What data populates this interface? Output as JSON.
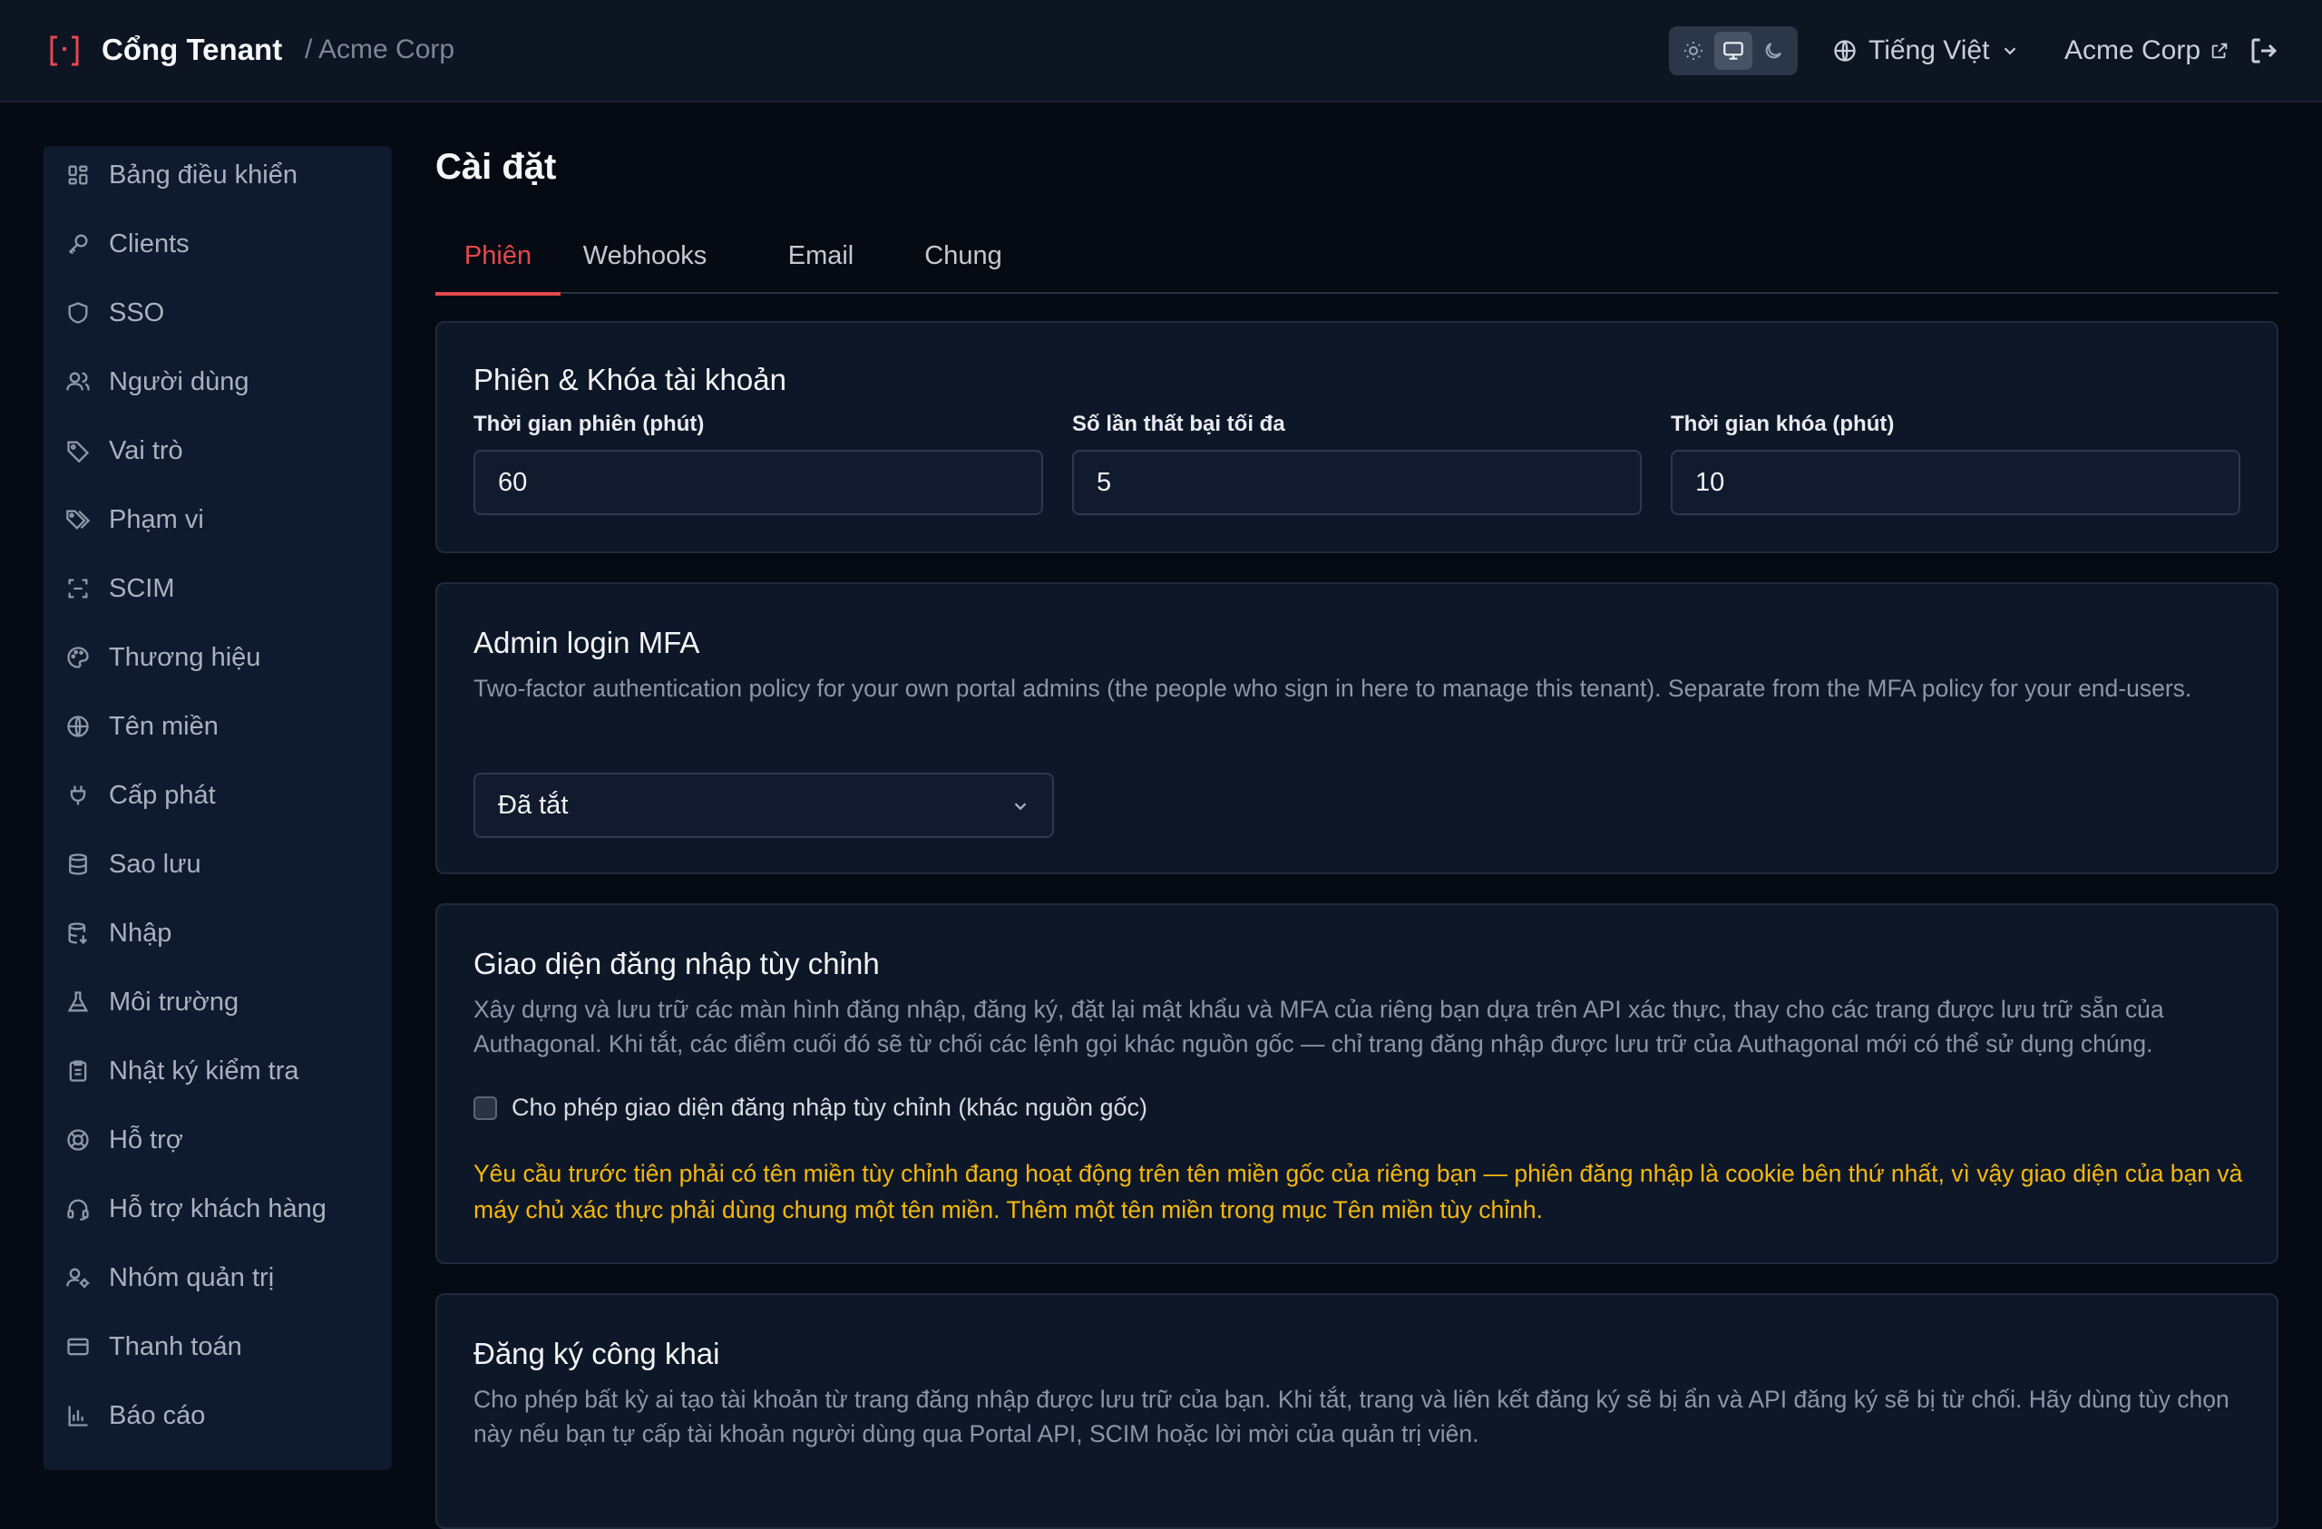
{
  "header": {
    "title": "Cổng Tenant",
    "breadcrumb": "/ Acme Corp",
    "language": "Tiếng Việt",
    "tenant_link": "Acme Corp",
    "theme_modes": [
      "light",
      "system",
      "dark"
    ],
    "theme_active": "system"
  },
  "sidebar": {
    "items": [
      {
        "label": "Bảng điều khiển",
        "icon": "dashboard-icon"
      },
      {
        "label": "Clients",
        "icon": "key-icon"
      },
      {
        "label": "SSO",
        "icon": "shield-icon"
      },
      {
        "label": "Người dùng",
        "icon": "users-icon"
      },
      {
        "label": "Vai trò",
        "icon": "tag-icon"
      },
      {
        "label": "Phạm vi",
        "icon": "tags-icon"
      },
      {
        "label": "SCIM",
        "icon": "scan-icon"
      },
      {
        "label": "Thương hiệu",
        "icon": "palette-icon"
      },
      {
        "label": "Tên miền",
        "icon": "globe-icon"
      },
      {
        "label": "Cấp phát",
        "icon": "plug-icon"
      },
      {
        "label": "Sao lưu",
        "icon": "database-icon"
      },
      {
        "label": "Nhập",
        "icon": "database-import-icon"
      },
      {
        "label": "Môi trường",
        "icon": "flask-icon"
      },
      {
        "label": "Nhật ký kiểm tra",
        "icon": "clipboard-list-icon"
      },
      {
        "label": "Hỗ trợ",
        "icon": "lifebuoy-icon"
      },
      {
        "label": "Hỗ trợ khách hàng",
        "icon": "headset-icon"
      },
      {
        "label": "Nhóm quản trị",
        "icon": "user-cog-icon"
      },
      {
        "label": "Thanh toán",
        "icon": "credit-card-icon"
      },
      {
        "label": "Báo cáo",
        "icon": "bar-chart-icon"
      }
    ]
  },
  "main": {
    "title": "Cài đặt",
    "tabs": [
      {
        "label": "Phiên",
        "active": true
      },
      {
        "label": "Webhooks",
        "active": false
      },
      {
        "label": "Email",
        "active": false
      },
      {
        "label": "Chung",
        "active": false
      }
    ],
    "session_card": {
      "title": "Phiên & Khóa tài khoản",
      "fields": [
        {
          "label": "Thời gian phiên (phút)",
          "value": "60"
        },
        {
          "label": "Số lần thất bại tối đa",
          "value": "5"
        },
        {
          "label": "Thời gian khóa (phút)",
          "value": "10"
        }
      ]
    },
    "mfa_card": {
      "title": "Admin login MFA",
      "description": "Two-factor authentication policy for your own portal admins (the people who sign in here to manage this tenant). Separate from the MFA policy for your end-users.",
      "select_value": "Đã tắt"
    },
    "custom_login_card": {
      "title": "Giao diện đăng nhập tùy chỉnh",
      "description": "Xây dựng và lưu trữ các màn hình đăng nhập, đăng ký, đặt lại mật khẩu và MFA của riêng bạn dựa trên API xác thực, thay cho các trang được lưu trữ sẵn của Authagonal. Khi tắt, các điểm cuối đó sẽ từ chối các lệnh gọi khác nguồn gốc — chỉ trang đăng nhập được lưu trữ của Authagonal mới có thể sử dụng chúng.",
      "checkbox_label": "Cho phép giao diện đăng nhập tùy chỉnh (khác nguồn gốc)",
      "checkbox_checked": false,
      "warning": "Yêu cầu trước tiên phải có tên miền tùy chỉnh đang hoạt động trên tên miền gốc của riêng bạn — phiên đăng nhập là cookie bên thứ nhất, vì vậy giao diện của bạn và máy chủ xác thực phải dùng chung một tên miền. Thêm một tên miền trong mục Tên miền tùy chỉnh."
    },
    "public_signup_card": {
      "title": "Đăng ký công khai",
      "description": "Cho phép bất kỳ ai tạo tài khoản từ trang đăng nhập được lưu trữ của bạn. Khi tắt, trang và liên kết đăng ký sẽ bị ẩn và API đăng ký sẽ bị từ chối. Hãy dùng tùy chọn này nếu bạn tự cấp tài khoản người dùng qua Portal API, SCIM hoặc lời mời của quản trị viên."
    }
  },
  "colors": {
    "accent": "#e5484d",
    "warning": "#f5b80b",
    "background": "#060a13",
    "card": "#0e1728"
  }
}
